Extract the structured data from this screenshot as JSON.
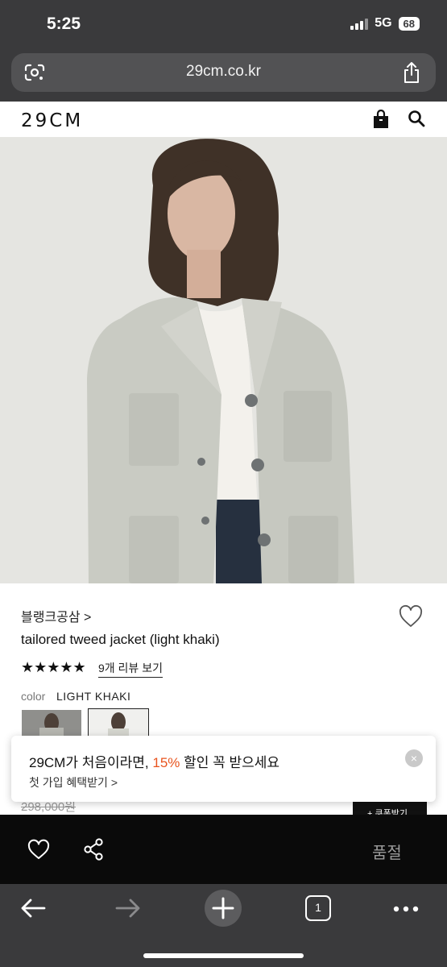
{
  "status": {
    "time": "5:25",
    "network": "5G",
    "battery": "68"
  },
  "browser": {
    "url": "29cm.co.kr",
    "tab_count": "1"
  },
  "site": {
    "logo": "29CM"
  },
  "product": {
    "brand": "블랭크공삼 >",
    "title": "tailored tweed jacket (light khaki)",
    "stars": "★★★★★",
    "rating": 5,
    "review_link": "9개 리뷰 보기",
    "color_label": "color",
    "color_value": "LIGHT KHAKI",
    "old_price": "298,000원",
    "coupon_label": "+ 쿠폰받기"
  },
  "promo": {
    "main_before": "29CM가 처음이라면, ",
    "main_highlight": "15%",
    "main_after": " 할인 꼭 받으세요",
    "sub": "첫 가입 혜택받기 >",
    "close": "×"
  },
  "action_bar": {
    "soldout_label": "품절"
  },
  "icons": {
    "lens": "google-lens-icon",
    "share": "share-icon",
    "bag": "shopping-bag-icon",
    "search": "search-icon",
    "heart": "heart-icon",
    "nodes": "share-nodes-icon",
    "back": "arrow-left-icon",
    "forward": "arrow-right-icon",
    "plus": "plus-icon",
    "more": "more-dots-icon"
  },
  "colors": {
    "accent": "#e8541e",
    "chrome": "#3a3a3c",
    "action_bar": "#0a0a0a"
  }
}
